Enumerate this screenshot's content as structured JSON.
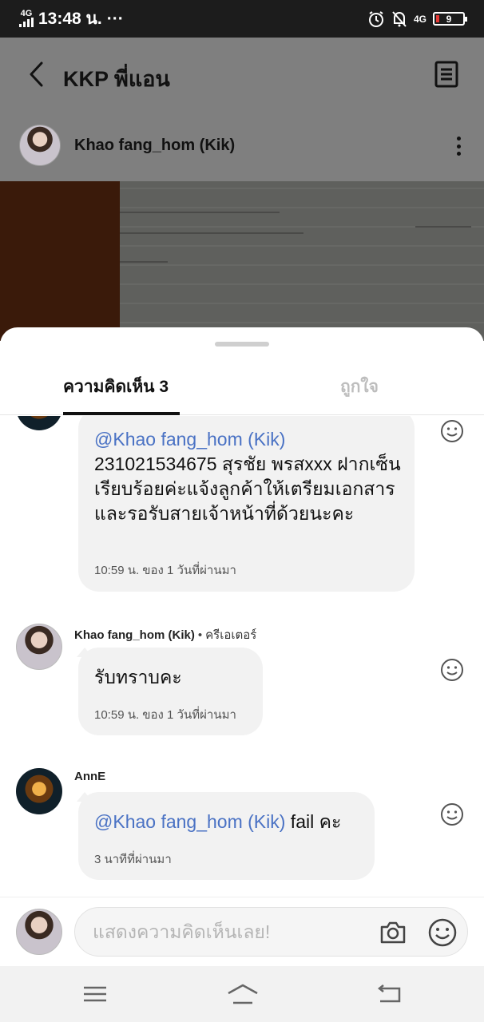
{
  "status_bar": {
    "network_top": "4G",
    "time": "13:48 น.",
    "more": "···",
    "net_type": "4G",
    "battery": "9"
  },
  "header": {
    "title": "KKP พี่แอน",
    "creator_name": "Khao fang_hom (Kik)"
  },
  "tabs": {
    "comments": "ความคิดเห็น 3",
    "likes": "ถูกใจ"
  },
  "comments": [
    {
      "mention": "@Khao fang_hom (Kik)",
      "text": "231021534675 สุรชัย พรสxxx ฝากเซ็นเรียบร้อยค่ะแจ้งลูกค้าให้เตรียมเอกสารและรอรับสายเจ้าหน้าที่ด้วยนะคะ",
      "time": "10:59 น. ของ 1 วันที่ผ่านมา"
    },
    {
      "author": "Khao fang_hom (Kik)",
      "separator": "•",
      "role": "ครีเอเตอร์",
      "text": "รับทราบคะ",
      "time": "10:59 น. ของ 1 วันที่ผ่านมา"
    },
    {
      "author": "AnnE",
      "mention": "@Khao fang_hom (Kik)",
      "text": " fail คะ",
      "time": "3 นาทีที่ผ่านมา"
    }
  ],
  "input": {
    "placeholder": "แสดงความคิดเห็นเลย!"
  },
  "colors": {
    "mention": "#4a72c4",
    "bubble": "#f2f2f2",
    "header_overlay": "#7f7f7f",
    "tab_inactive": "#bdbdbd"
  },
  "icons": {
    "back": "chevron-left-icon",
    "doc": "document-icon",
    "more": "more-vertical-icon",
    "react": "smiley-icon",
    "camera": "camera-icon",
    "emoji": "emoji-icon"
  }
}
